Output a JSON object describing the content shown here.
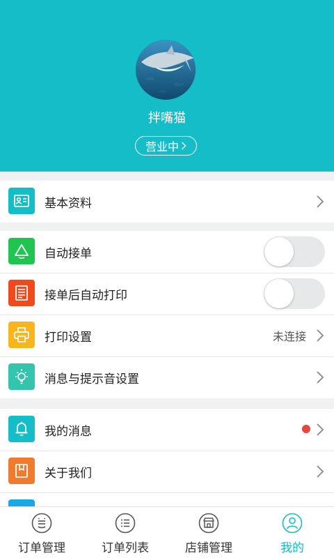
{
  "profile": {
    "shop_name": "拌嘴猫",
    "status_label": "营业中"
  },
  "menu": {
    "basic_info": "基本资料",
    "auto_accept": "自动接单",
    "auto_print": "接单后自动打印",
    "print_settings": "打印设置",
    "print_status": "未连接",
    "notify_settings": "消息与提示音设置",
    "my_messages": "我的消息",
    "about_us": "关于我们"
  },
  "toggles": {
    "auto_accept": false,
    "auto_print": false
  },
  "tabs": [
    "订单管理",
    "订单列表",
    "店铺管理",
    "我的"
  ],
  "colors": {
    "brand": "#14bdc8",
    "icon_basic": "#14bdc8",
    "icon_auto_accept": "#1fc451",
    "icon_auto_print": "#f04a1c",
    "icon_print": "#f8b51c",
    "icon_notify": "#33c4ad",
    "icon_messages": "#14bdc8",
    "icon_about": "#f07a2e",
    "unread_dot": "#e8453c"
  }
}
